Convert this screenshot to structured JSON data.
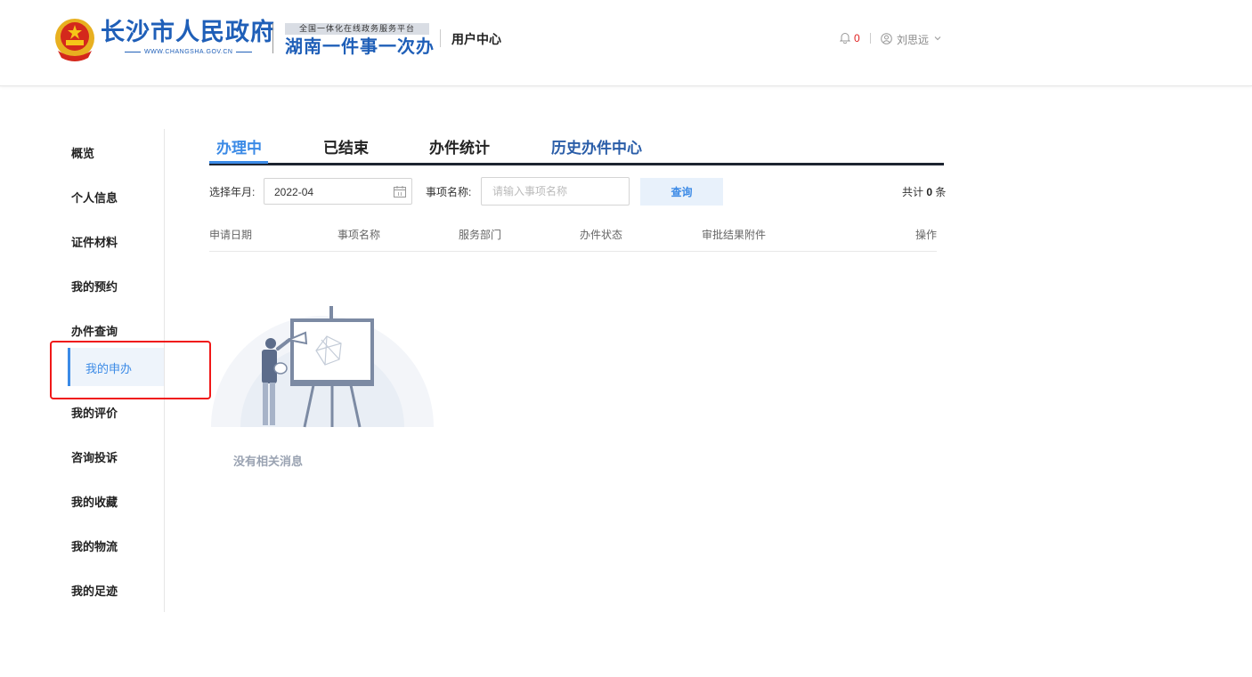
{
  "header": {
    "gov_name": "长沙市人民政府",
    "gov_url": "WWW.CHANGSHA.GOV.CN",
    "platform_subtitle": "全国一体化在线政务服务平台",
    "platform_name": "湖南一件事一次办",
    "section_title": "用户中心",
    "notification_count": "0",
    "user_name": "刘思远",
    "icons": [
      "national-emblem-icon",
      "bell-icon",
      "user-icon",
      "chevron-down-icon"
    ]
  },
  "sidebar": {
    "items": [
      {
        "label": "概览"
      },
      {
        "label": "个人信息"
      },
      {
        "label": "证件材料"
      },
      {
        "label": "我的预约"
      },
      {
        "label": "办件查询"
      },
      {
        "label": "我的申办"
      },
      {
        "label": "我的评价"
      },
      {
        "label": "咨询投诉"
      },
      {
        "label": "我的收藏"
      },
      {
        "label": "我的物流"
      },
      {
        "label": "我的足迹"
      }
    ],
    "active_label": "我的申办"
  },
  "tabs": [
    {
      "label": "办理中"
    },
    {
      "label": "已结束"
    },
    {
      "label": "办件统计"
    },
    {
      "label": "历史办件中心"
    }
  ],
  "filters": {
    "month_label": "选择年月:",
    "month_value": "2022-04",
    "name_label": "事项名称:",
    "name_placeholder": "请输入事项名称",
    "query_label": "查询",
    "total_prefix": "共计",
    "total_count": "0",
    "total_suffix": "条"
  },
  "table": {
    "columns": [
      "申请日期",
      "事项名称",
      "服务部门",
      "办件状态",
      "审批结果附件",
      "操作"
    ]
  },
  "empty_state": {
    "message": "没有相关消息"
  },
  "colors": {
    "brand_blue": "#1f5fb8",
    "accent_blue": "#3b8ae6",
    "highlight_red": "#f01818",
    "notification_red": "#e02020"
  }
}
